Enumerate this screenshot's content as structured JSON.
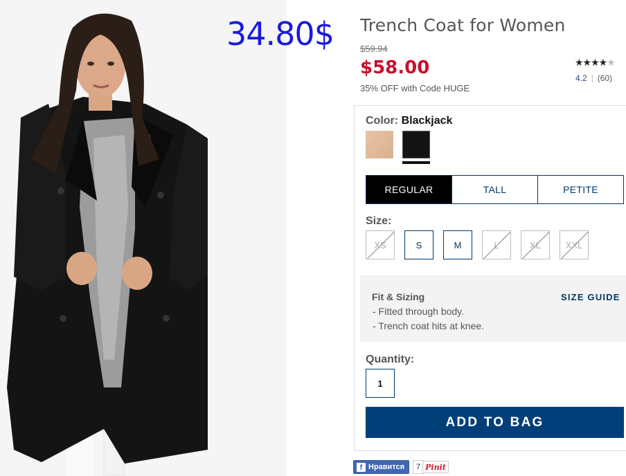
{
  "overlay_price": "34.80$",
  "product": {
    "title": "Trench Coat for Women",
    "old_price": "$59.94",
    "price": "$58.00",
    "promo": "35% OFF with Code HUGE",
    "rating": {
      "stars_filled": "★★★★",
      "stars_empty": "★",
      "score": "4.2",
      "reviews": "(60)",
      "value": 4.2,
      "max": 5
    }
  },
  "color": {
    "label": "Color:",
    "selected": "Blackjack",
    "swatches": [
      {
        "name": "tan",
        "hex": "#e2bd9c"
      },
      {
        "name": "blackjack",
        "hex": "#141414"
      }
    ]
  },
  "fit_tabs": [
    "REGULAR",
    "TALL",
    "PETITE"
  ],
  "size": {
    "label": "Size:",
    "options": [
      {
        "label": "XS",
        "available": false
      },
      {
        "label": "S",
        "available": true
      },
      {
        "label": "M",
        "available": true
      },
      {
        "label": "L",
        "available": false
      },
      {
        "label": "XL",
        "available": false
      },
      {
        "label": "XXL",
        "available": false
      }
    ]
  },
  "fit_sizing": {
    "title": "Fit & Sizing",
    "guide_link": "SIZE GUIDE",
    "lines": [
      "- Fitted through body.",
      "- Trench coat hits at knee."
    ]
  },
  "quantity": {
    "label": "Quantity:",
    "value": "1"
  },
  "add_to_bag": "ADD TO BAG",
  "social": {
    "fb_label": "Нравится",
    "fb_count": "7",
    "pin_label": "Pinit"
  },
  "colors": {
    "brand_navy": "#003764",
    "price_red": "#c8102e",
    "overlay_blue": "#1a1adf",
    "fb_blue": "#4267b2"
  }
}
